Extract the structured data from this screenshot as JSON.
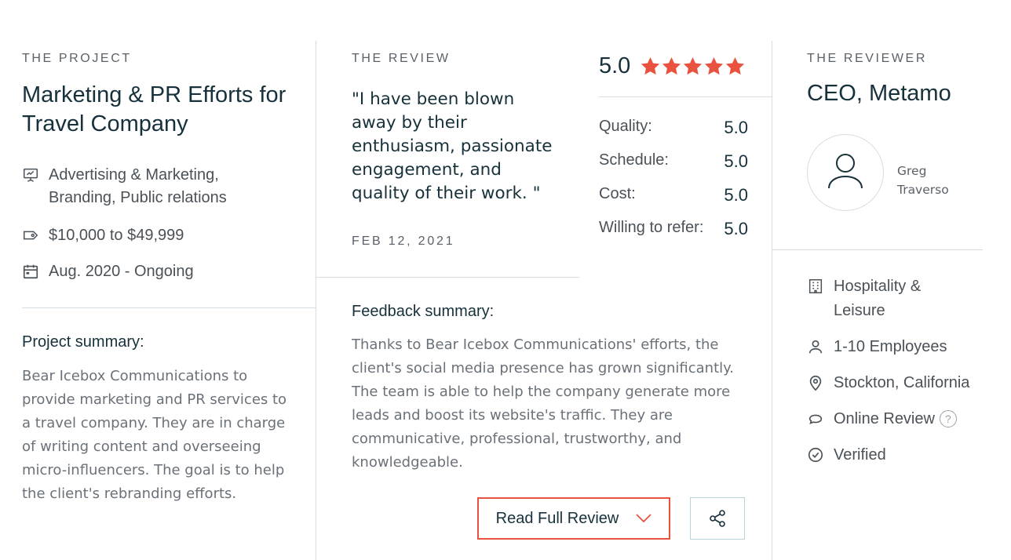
{
  "colors": {
    "accent": "#e8523e",
    "heading": "#17313b",
    "muted": "#6a7178",
    "divider": "#d6dde3"
  },
  "project": {
    "eyebrow": "THE PROJECT",
    "title": "Marketing & PR Efforts for Travel Company",
    "services": "Advertising & Marketing, Branding, Public relations",
    "budget": "$10,000 to $49,999",
    "timeline": "Aug. 2020 - Ongoing",
    "summary_label": "Project summary:",
    "summary_text": "Bear Icebox Communications to provide marketing and PR services to a travel company. They are in charge of writing content and overseeing micro-influencers. The goal is to help the client's rebranding efforts."
  },
  "review": {
    "eyebrow": "THE REVIEW",
    "quote": "\"I have been blown away by their enthusiasm, passionate engagement, and quality of their work. \"",
    "date": "FEB 12, 2021",
    "overall": "5.0",
    "stars": 5,
    "scores": [
      {
        "label": "Quality:",
        "value": "5.0"
      },
      {
        "label": "Schedule:",
        "value": "5.0"
      },
      {
        "label": "Cost:",
        "value": "5.0"
      },
      {
        "label": "Willing to refer:",
        "value": "5.0"
      }
    ],
    "feedback_label": "Feedback summary:",
    "feedback_text": "Thanks to Bear Icebox Communications' efforts, the client's social media presence has grown significantly. The team is able to help the company generate more leads and boost its website's traffic. They are communicative, professional, trustworthy, and knowledgeable.",
    "read_full_label": "Read Full Review"
  },
  "reviewer": {
    "eyebrow": "THE REVIEWER",
    "title": "CEO, Metamo",
    "name": "Greg Traverso",
    "industry": "Hospitality & Leisure",
    "size": "1-10 Employees",
    "location": "Stockton, California",
    "review_type": "Online Review",
    "help_glyph": "?",
    "verified": "Verified"
  },
  "icons": [
    "presentation-icon",
    "price-tag-icon",
    "calendar-icon",
    "star-icon",
    "chevron-down-icon",
    "share-icon",
    "user-avatar-icon",
    "building-icon",
    "person-icon",
    "location-pin-icon",
    "chat-bubble-icon",
    "help-icon",
    "check-circle-icon"
  ]
}
